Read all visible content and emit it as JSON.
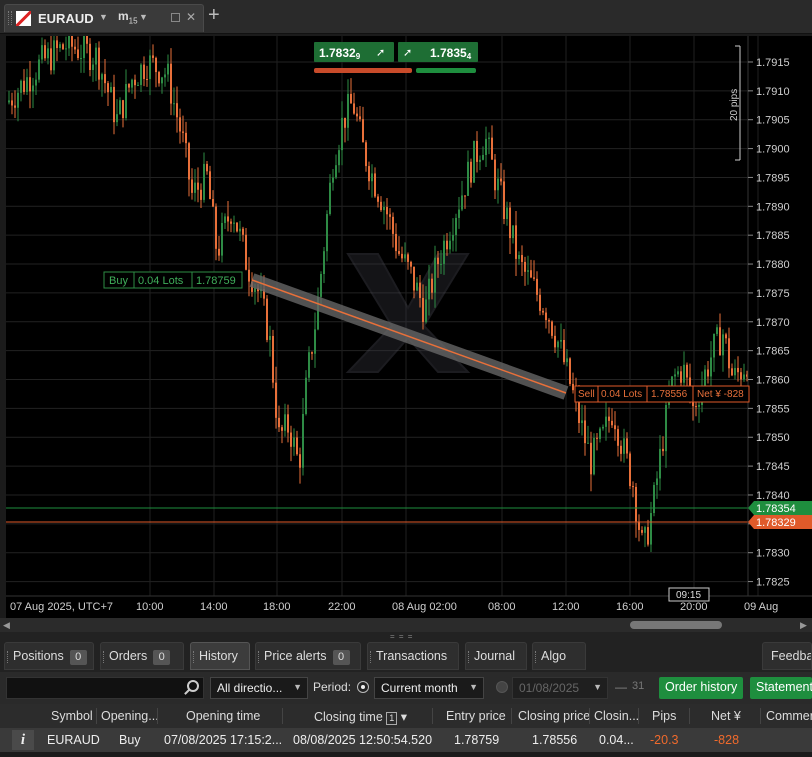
{
  "chart_tab": {
    "symbol": "EURAUD",
    "timeframe_main": "m",
    "timeframe_sub": "15"
  },
  "quotes": {
    "sell_price": "1.7832",
    "sell_pip": "9",
    "buy_price": "1.7835",
    "buy_pip": "4"
  },
  "chart_labels": {
    "pips_ruler": "20 pips",
    "buy_tag": [
      "Buy",
      "0.04 Lots",
      "1.78759"
    ],
    "sell_tag": [
      "Sell",
      "0.04 Lots",
      "1.78556",
      "Net ¥ -828"
    ],
    "ask_tag": "1.78354",
    "bid_tag": "1.78329",
    "crosshair_time": "09:15"
  },
  "colors": {
    "bull": "#2e8b45",
    "bear": "#e8703a",
    "ask": "#1e8e3e",
    "bid": "#e05a2a"
  },
  "chart_data": {
    "type": "candlestick",
    "y_ticks": [
      "1.7915",
      "1.7910",
      "1.7905",
      "1.7900",
      "1.7895",
      "1.7890",
      "1.7885",
      "1.7880",
      "1.7875",
      "1.7870",
      "1.7865",
      "1.7860",
      "1.7855",
      "1.7850",
      "1.7845",
      "1.7840",
      "1.7835",
      "1.7830",
      "1.7825"
    ],
    "ylim": [
      1.78225,
      1.79195
    ],
    "x_ticks": [
      "07 Aug 2025, UTC+7",
      "10:00",
      "14:00",
      "18:00",
      "22:00",
      "08 Aug 02:00",
      "08:00",
      "12:00",
      "16:00",
      "20:00",
      "09 Aug"
    ],
    "trade": {
      "side": "Buy",
      "open_price": 1.78759,
      "close_price": 1.78556,
      "net": "-828"
    },
    "ask_price": 1.78354,
    "bid_price": 1.78329
  },
  "bottom_tabs": [
    {
      "label": "Positions",
      "badge": "0"
    },
    {
      "label": "Orders",
      "badge": "0"
    },
    {
      "label": "History"
    },
    {
      "label": "Price alerts",
      "badge": "0"
    },
    {
      "label": "Transactions"
    },
    {
      "label": "Journal"
    },
    {
      "label": "Algo"
    },
    {
      "label": "Feedback"
    }
  ],
  "toolbar": {
    "direction": "All directio...",
    "period_label": "Period:",
    "period_value": "Current month",
    "from_date": "01/08/2025",
    "to_date_hint": "31",
    "order_history": "Order history",
    "statement": "Statement"
  },
  "table": {
    "headers": [
      "Symbol",
      "Opening...",
      "Opening time",
      "Closing time",
      "Entry price",
      "Closing price",
      "Closin...",
      "Pips",
      "Net ¥",
      "Commer"
    ],
    "sort_index": "1",
    "sort_arrow": "▾",
    "row": {
      "info": "i",
      "symbol": "EURAUD",
      "direction": "Buy",
      "opening_time": "07/08/2025 17:15:2...",
      "closing_time": "08/08/2025 12:50:54.520",
      "entry_price": "1.78759",
      "closing_price": "1.78556",
      "closing_qty": "0.04...",
      "pips": "-20.3",
      "net": "-828"
    }
  }
}
